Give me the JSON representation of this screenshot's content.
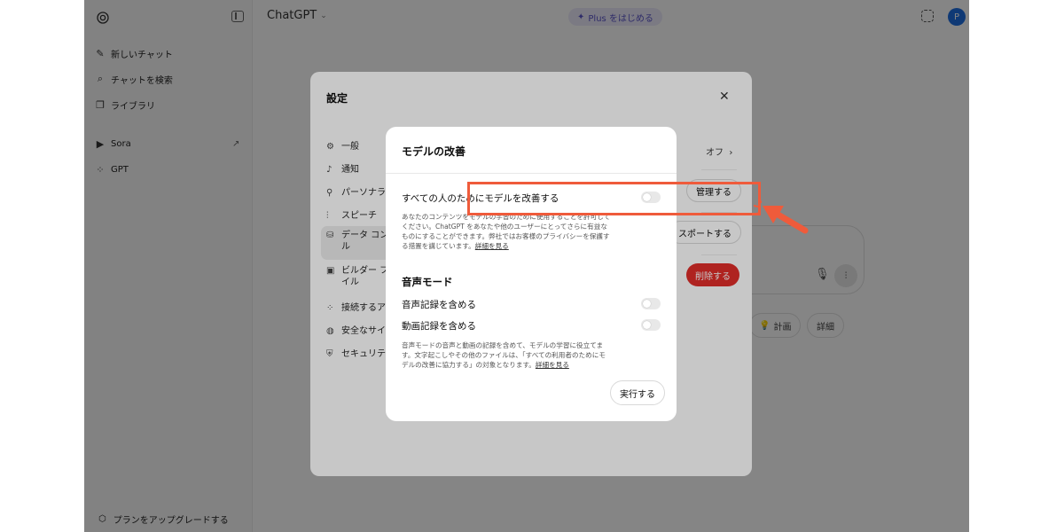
{
  "topbar": {
    "title": "ChatGPT",
    "plus_label": "Plus をはじめる",
    "avatar_letter": "P"
  },
  "sidebar": {
    "items": [
      {
        "label": "新しいチャット",
        "icon": "edit-icon"
      },
      {
        "label": "チャットを検索",
        "icon": "search-icon"
      },
      {
        "label": "ライブラリ",
        "icon": "library-icon"
      },
      {
        "label": "Sora",
        "icon": "sora-icon"
      },
      {
        "label": "GPT",
        "icon": "grid-icon"
      }
    ],
    "upgrade_label": "プランをアップグレードする"
  },
  "background_chips": [
    {
      "label": "計画",
      "icon": "lightbulb-icon"
    },
    {
      "label": "詳細"
    }
  ],
  "settings": {
    "title": "設定",
    "nav": [
      {
        "label": "一般",
        "icon": "gear-icon"
      },
      {
        "label": "通知",
        "icon": "bell-icon"
      },
      {
        "label": "パーソナラ",
        "icon": "person-icon"
      },
      {
        "label": "スピーチ",
        "icon": "waveform-icon"
      },
      {
        "label_line1": "データ コン",
        "label_line2": "ル",
        "icon": "database-icon"
      },
      {
        "label_line1": "ビルダー フ",
        "label_line2": "イル",
        "icon": "profile-card-icon"
      },
      {
        "label": "接続するア",
        "icon": "apps-icon"
      },
      {
        "label": "安全なサイ",
        "icon": "globe-icon"
      },
      {
        "label": "セキュリテ",
        "icon": "shield-icon"
      }
    ],
    "off_label": "オフ",
    "manage_label": "管理する",
    "export_label": "スポートする",
    "delete_label": "削除する"
  },
  "modal": {
    "title": "モデルの改善",
    "improve_label": "すべての人のためにモデルを改善する",
    "improve_on": false,
    "improve_desc_line1": "あなたのコンテンツをモデルの学習のために使用することを許可して",
    "improve_desc_line2": "ください。ChatGPT をあなたや他のユーザーにとってさらに有益な",
    "improve_desc_line3": "ものにすることができます。弊社ではお客様のプライバシーを保護す",
    "improve_desc_line4": "る措置を講じています。",
    "improve_link": "詳細を見る",
    "voice_section_title": "音声モード",
    "include_audio_label": "音声記録を含める",
    "include_audio_on": false,
    "include_video_label": "動画記録を含める",
    "include_video_on": false,
    "voice_desc_line1": "音声モードの音声と動画の記録を含めて、モデルの学習に役立てま",
    "voice_desc_line2": "す。文字起こしやその他のファイルは、「すべての利用者のためにモ",
    "voice_desc_line3": "デルの改善に協力する」の対象となります。",
    "voice_link": "詳細を見る",
    "run_label": "実行する"
  },
  "colors": {
    "highlight": "#ef5b3b",
    "delete_button": "#e02e2a",
    "avatar": "#1f6fe0"
  }
}
